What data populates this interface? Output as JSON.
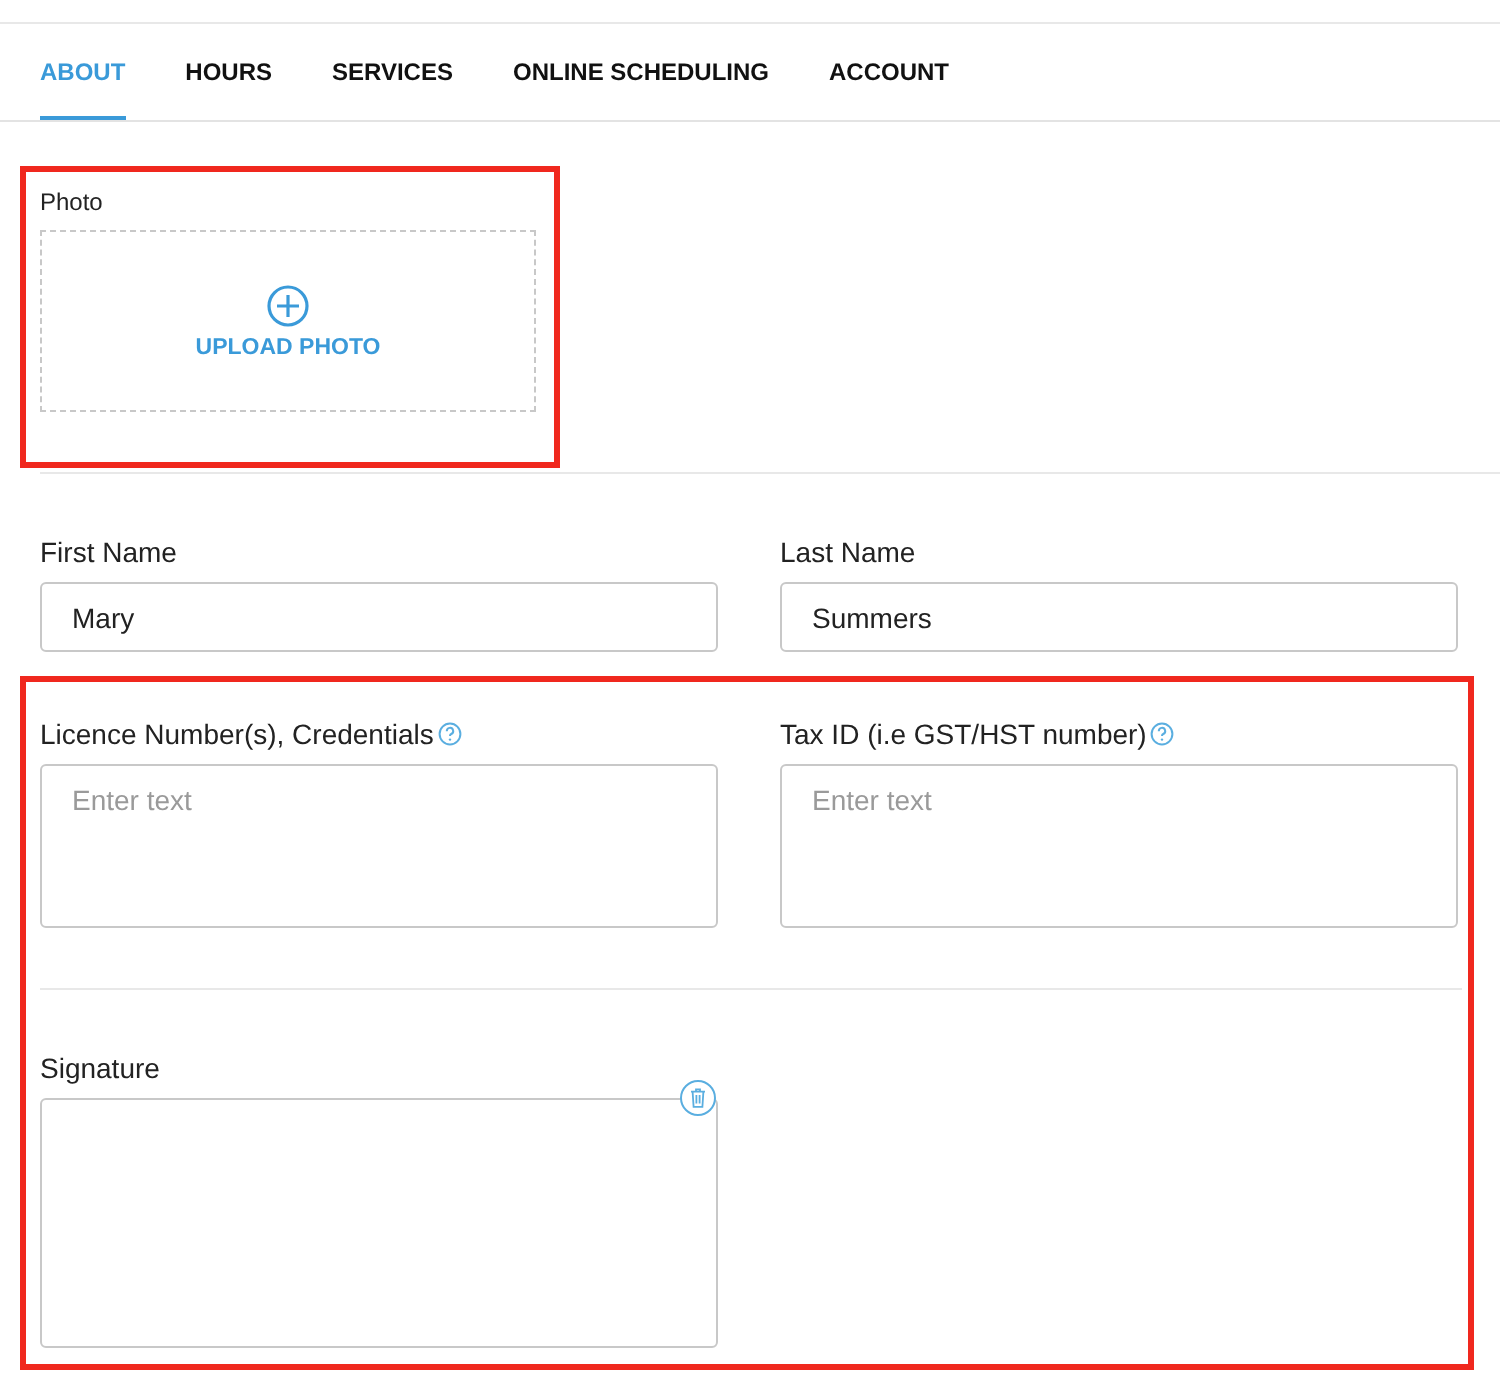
{
  "tabs": [
    {
      "label": "ABOUT",
      "selected": true
    },
    {
      "label": "HOURS",
      "selected": false
    },
    {
      "label": "SERVICES",
      "selected": false
    },
    {
      "label": "ONLINE SCHEDULING",
      "selected": false
    },
    {
      "label": "ACCOUNT",
      "selected": false
    }
  ],
  "photo_section": {
    "highlighted": true,
    "label": "Photo",
    "upload_label": "UPLOAD PHOTO"
  },
  "name_fields": [
    {
      "label": "First Name",
      "value": "Mary"
    },
    {
      "label": "Last Name",
      "value": "Summers"
    }
  ],
  "details_section": {
    "highlighted": true,
    "fields": [
      {
        "label": "Licence Number(s), Credentials",
        "help": true,
        "placeholder": "Enter text"
      },
      {
        "label": "Tax ID (i.e GST/HST number)",
        "help": true,
        "placeholder": "Enter text"
      }
    ],
    "signature": {
      "label": "Signature",
      "deletable": true
    }
  }
}
